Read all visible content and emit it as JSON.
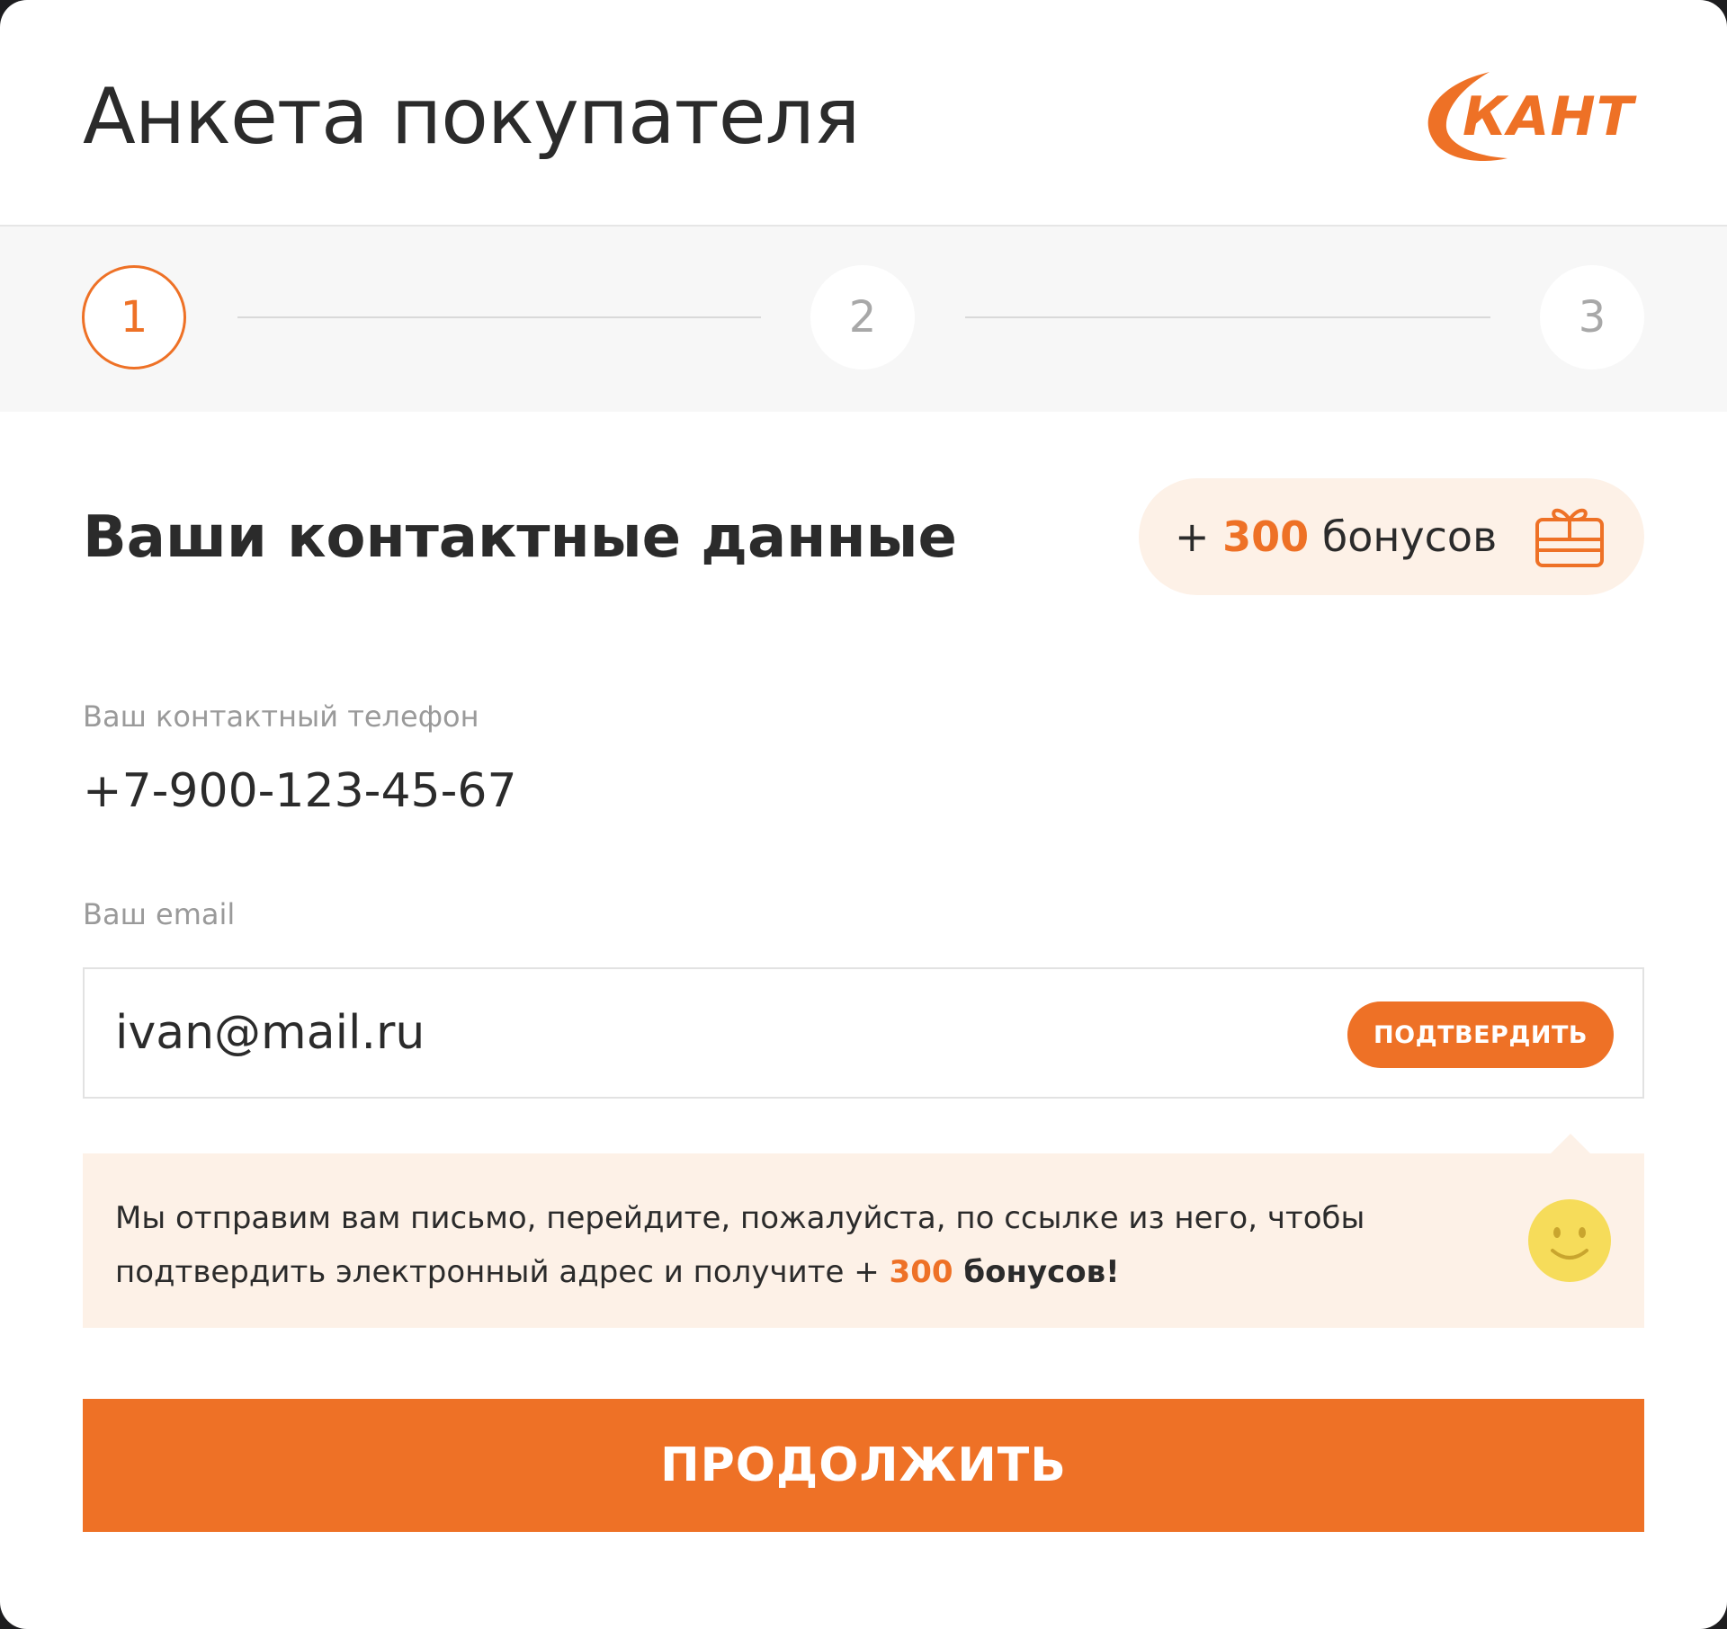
{
  "header": {
    "title": "Анкета покупателя",
    "logo_text": "КАНТ"
  },
  "stepper": {
    "steps": [
      {
        "label": "1",
        "state": "active"
      },
      {
        "label": "2",
        "state": "idle"
      },
      {
        "label": "3",
        "state": "idle"
      }
    ],
    "current": 1
  },
  "section": {
    "title": "Ваши контактные данные",
    "bonus": {
      "prefix": "+ ",
      "amount": "300",
      "suffix": " бонусов",
      "icon": "gift-icon"
    }
  },
  "phone": {
    "label": "Ваш контактный телефон",
    "value": "+7-900-123-45-67"
  },
  "email": {
    "label": "Ваш email",
    "value": "ivan@mail.ru",
    "confirm_label": "ПОДТВЕРДИТЬ"
  },
  "hint": {
    "text": "Мы отправим вам письмо, перейдите, пожалуйста, по ссылке из него, чтобы подтвердить электронный адрес и получите + ",
    "amount": "300",
    "suffix": " бонусов!",
    "icon": "smiley-icon"
  },
  "actions": {
    "continue_label": "ПРОДОЛЖИТЬ"
  },
  "colors": {
    "accent": "#ee7126",
    "accent_light": "#fdf1e7",
    "text": "#2b2b2b",
    "muted": "#9a9a9a",
    "smiley": "#f6dc5a"
  }
}
